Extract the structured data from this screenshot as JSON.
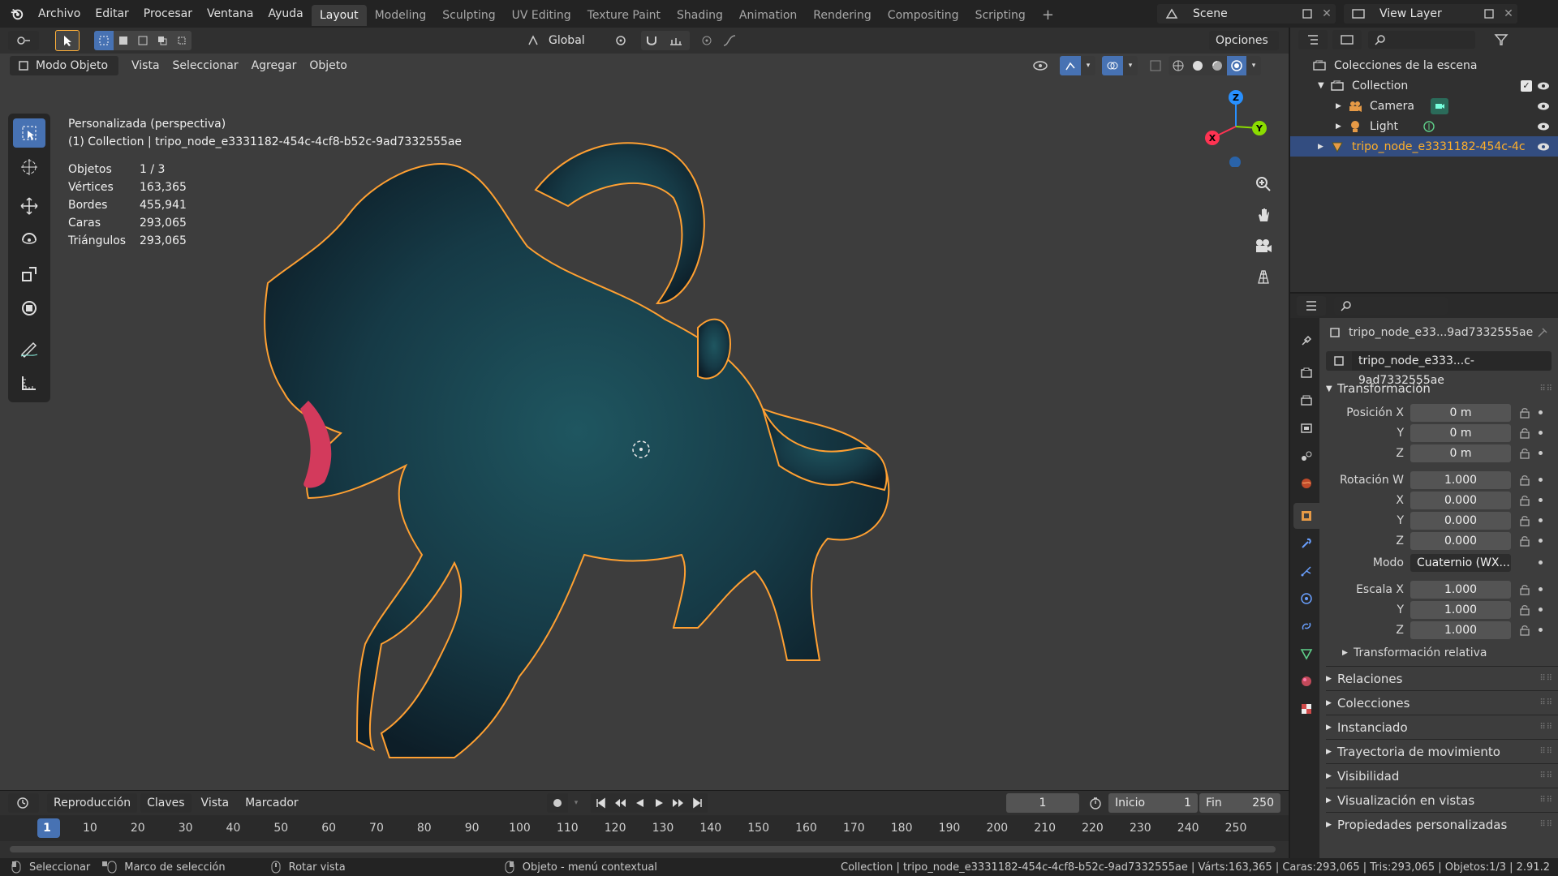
{
  "menus": [
    "Archivo",
    "Editar",
    "Procesar",
    "Ventana",
    "Ayuda"
  ],
  "workspaces": [
    {
      "label": "Layout",
      "active": true
    },
    {
      "label": "Modeling",
      "active": false
    },
    {
      "label": "Sculpting",
      "active": false
    },
    {
      "label": "UV Editing",
      "active": false
    },
    {
      "label": "Texture Paint",
      "active": false
    },
    {
      "label": "Shading",
      "active": false
    },
    {
      "label": "Animation",
      "active": false
    },
    {
      "label": "Rendering",
      "active": false
    },
    {
      "label": "Compositing",
      "active": false
    },
    {
      "label": "Scripting",
      "active": false
    }
  ],
  "add_workspace": "+",
  "scene": "Scene",
  "view_layer": "View Layer",
  "viewport_header": {
    "transform_orientation": "Global",
    "options": "Opciones",
    "mode": "Modo Objeto",
    "menus": [
      "Vista",
      "Seleccionar",
      "Agregar",
      "Objeto"
    ]
  },
  "overlay": {
    "view_name": "Personalizada (perspectiva)",
    "collection_line": "(1) Collection | tripo_node_e3331182-454c-4cf8-b52c-9ad7332555ae",
    "stats": [
      {
        "label": "Objetos",
        "value": "1 / 3"
      },
      {
        "label": "Vértices",
        "value": "163,365"
      },
      {
        "label": "Bordes",
        "value": "455,941"
      },
      {
        "label": "Caras",
        "value": "293,065"
      },
      {
        "label": "Triángulos",
        "value": "293,065"
      }
    ]
  },
  "gizmo": {
    "x": "X",
    "y": "Y",
    "z": "Z"
  },
  "colors": {
    "accent": "#4772b3",
    "selection": "#ffa032",
    "axis_x": "#ff3352",
    "axis_y": "#8bdc00",
    "axis_z": "#2890ff",
    "selected_row": "#334d80"
  },
  "outliner": {
    "title": "Colecciones de la escena",
    "rows": [
      {
        "label": "Collection",
        "icon": "collection-icon"
      },
      {
        "label": "Camera",
        "icon": "camera-icon"
      },
      {
        "label": "Light",
        "icon": "light-icon"
      },
      {
        "label": "tripo_node_e3331182-454c-4c",
        "icon": "mesh-icon",
        "selected": true
      }
    ]
  },
  "properties": {
    "object_name": "tripo_node_e33...9ad7332555ae",
    "object_field": "tripo_node_e333...c-9ad7332555ae",
    "transform_title": "Transformación",
    "location_label": "Posición X",
    "rotation_label": "Rotación W",
    "scale_label": "Escala X",
    "axis_labels": [
      "X",
      "Y",
      "Z"
    ],
    "location": [
      "0 m",
      "0 m",
      "0 m"
    ],
    "rotation": [
      "1.000",
      "0.000",
      "0.000",
      "0.000"
    ],
    "mode_label": "Modo",
    "mode_value": "Cuaternio (WX...",
    "scale": [
      "1.000",
      "1.000",
      "1.000"
    ],
    "delta_title": "Transformación relativa",
    "sections": [
      "Relaciones",
      "Colecciones",
      "Instanciado",
      "Trayectoria de movimiento",
      "Visibilidad",
      "Visualización en vistas",
      "Propiedades personalizadas"
    ]
  },
  "timeline": {
    "menus": [
      "Reproducción",
      "Claves",
      "Vista",
      "Marcador"
    ],
    "current_frame": "1",
    "start_label": "Inicio",
    "start_value": "1",
    "end_label": "Fin",
    "end_value": "250",
    "ticks": [
      "1",
      "10",
      "20",
      "30",
      "40",
      "50",
      "60",
      "70",
      "80",
      "90",
      "100",
      "110",
      "120",
      "130",
      "140",
      "150",
      "160",
      "170",
      "180",
      "190",
      "200",
      "210",
      "220",
      "230",
      "240",
      "250"
    ]
  },
  "status": {
    "select": "Seleccionar",
    "box_select": "Marco de selección",
    "rotate_view": "Rotar vista",
    "context_menu": "Objeto - menú contextual",
    "info": "Collection | tripo_node_e3331182-454c-4cf8-b52c-9ad7332555ae | Várts:163,365 | Caras:293,065 | Tris:293,065 | Objetos:1/3 | 2.91.2"
  }
}
